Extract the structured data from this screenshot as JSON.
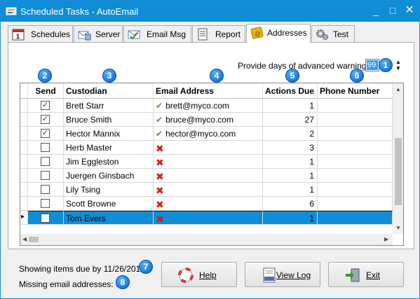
{
  "window": {
    "title": "Scheduled Tasks - AutoEmail",
    "min": "_",
    "max": "□",
    "close": "✕"
  },
  "tabs": [
    {
      "label": "Schedules",
      "icon": "calendar-icon"
    },
    {
      "label": "Server",
      "icon": "mail-server-icon"
    },
    {
      "label": "Email Msg",
      "icon": "email-message-icon"
    },
    {
      "label": "Report",
      "icon": "report-icon"
    },
    {
      "label": "Addresses",
      "icon": "address-book-icon",
      "active": true
    },
    {
      "label": "Test",
      "icon": "gears-icon"
    }
  ],
  "warning": {
    "label": "Provide days of advanced warning:",
    "value": "99",
    "spin_up": "▲",
    "spin_down": "▼"
  },
  "badges": [
    "1",
    "2",
    "3",
    "4",
    "5",
    "6",
    "7",
    "8"
  ],
  "grid": {
    "columns": [
      "Send",
      "Custodian",
      "Email Address",
      "Actions Due",
      "Phone Number"
    ],
    "rows": [
      {
        "send": true,
        "custodian": "Brett Starr",
        "email": "brett@myco.com",
        "valid": true,
        "due": "1"
      },
      {
        "send": true,
        "custodian": "Bruce Smith",
        "email": "bruce@myco.com",
        "valid": true,
        "due": "27"
      },
      {
        "send": true,
        "custodian": "Hector Mannix",
        "email": "hector@myco.com",
        "valid": true,
        "due": "2"
      },
      {
        "send": false,
        "custodian": "Herb Master",
        "email": "",
        "valid": false,
        "due": "3"
      },
      {
        "send": false,
        "custodian": "Jim Eggleston",
        "email": "",
        "valid": false,
        "due": "1"
      },
      {
        "send": false,
        "custodian": "Juergen Ginsbach",
        "email": "",
        "valid": false,
        "due": "1"
      },
      {
        "send": false,
        "custodian": "Lily Tsing",
        "email": "",
        "valid": false,
        "due": "1"
      },
      {
        "send": false,
        "custodian": "Scott Browne",
        "email": "",
        "valid": false,
        "due": "6"
      },
      {
        "send": false,
        "custodian": "Tom Evers",
        "email": "",
        "valid": false,
        "due": "1",
        "selected": true
      }
    ]
  },
  "status": {
    "due_text": "Showing items due by 11/26/2014",
    "missing_text": "Missing email addresses: 6"
  },
  "buttons": {
    "help": "Help",
    "view_log": "View Log",
    "exit": "Exit"
  },
  "colors": {
    "accent": "#0f8dd6",
    "ok": "#4aa02c",
    "error": "#d81b1b",
    "badge": "#1a73d9"
  }
}
